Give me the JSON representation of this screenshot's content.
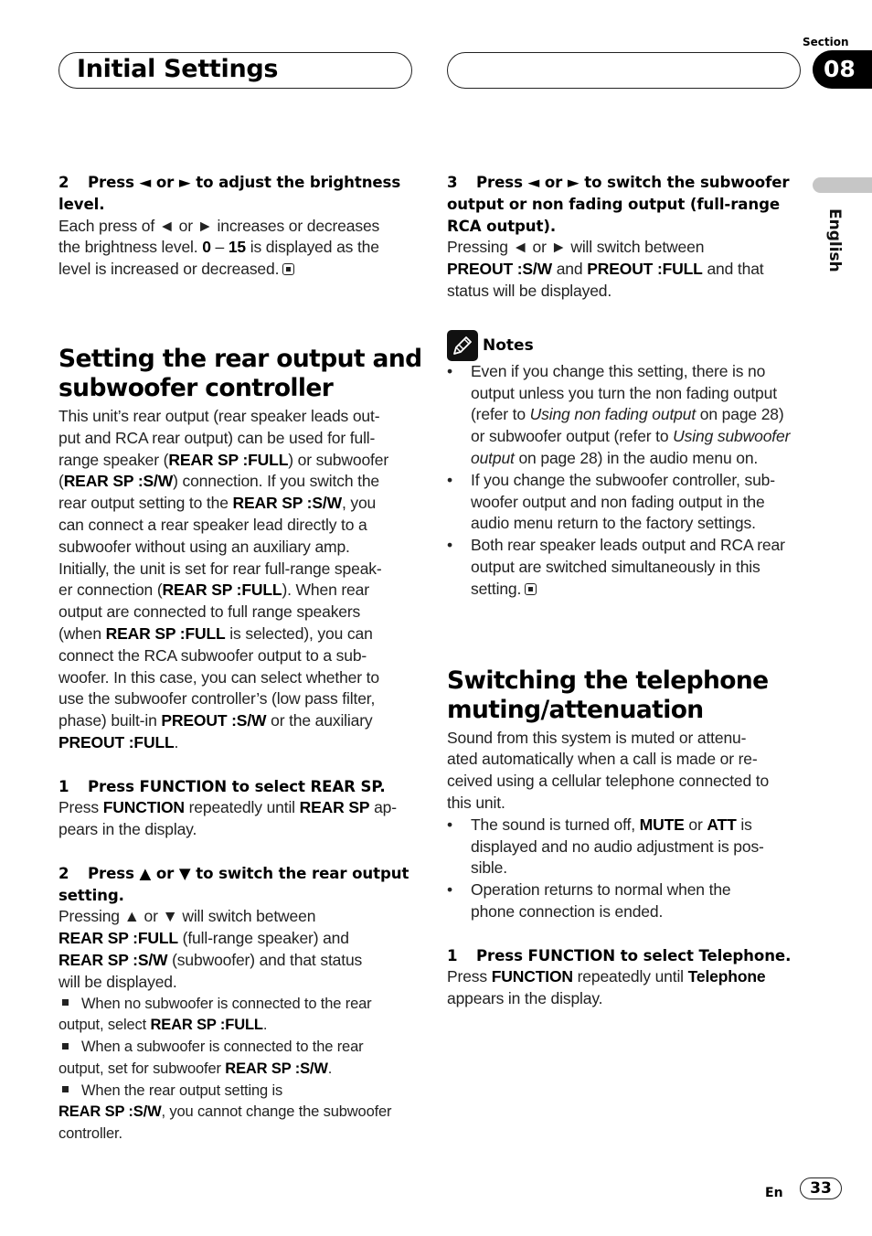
{
  "header": {
    "title": "Initial Settings",
    "section_label": "Section",
    "section_number": "08",
    "language": "English"
  },
  "footer": {
    "lang_code": "En",
    "page_number": "33"
  },
  "left_column": {
    "step2_brightness": {
      "heading_lines": [
        [
          {
            "t": "2",
            "num": true
          },
          {
            "t": "Press ◄ or ► to adjust the brightness"
          }
        ],
        [
          {
            "t": "level."
          }
        ]
      ],
      "body_lines": [
        [
          {
            "t": "Each press of ◄ or ► increases or decreases"
          }
        ],
        [
          {
            "t": "the brightness level. "
          },
          {
            "t": "0",
            "b": true
          },
          {
            "t": " – "
          },
          {
            "t": "15",
            "b": true
          },
          {
            "t": " is displayed as the"
          }
        ],
        [
          {
            "t": "level is increased or decreased."
          },
          {
            "end": true
          }
        ]
      ]
    },
    "rear_output_section": {
      "title_lines": [
        "Setting the rear output and",
        "subwoofer controller"
      ],
      "intro_lines": [
        [
          {
            "t": "This unit’s rear output (rear speaker leads out-"
          }
        ],
        [
          {
            "t": "put and RCA rear output) can be used for full-"
          }
        ],
        [
          {
            "t": "range speaker ("
          },
          {
            "t": "REAR SP :FULL",
            "b": true
          },
          {
            "t": ") or subwoofer"
          }
        ],
        [
          {
            "t": "("
          },
          {
            "t": "REAR SP :S/W",
            "b": true
          },
          {
            "t": ") connection. If you switch the"
          }
        ],
        [
          {
            "t": "rear output setting to the "
          },
          {
            "t": "REAR SP :S/W",
            "b": true
          },
          {
            "t": ", you"
          }
        ],
        [
          {
            "t": "can connect a rear speaker lead directly to a"
          }
        ],
        [
          {
            "t": "subwoofer without using an auxiliary amp."
          }
        ],
        [
          {
            "t": "Initially, the unit is set for rear full-range speak-"
          }
        ],
        [
          {
            "t": "er connection ("
          },
          {
            "t": "REAR SP :FULL",
            "b": true
          },
          {
            "t": "). When rear"
          }
        ],
        [
          {
            "t": "output are connected to full range speakers"
          }
        ],
        [
          {
            "t": "(when "
          },
          {
            "t": "REAR SP :FULL",
            "b": true
          },
          {
            "t": " is selected), you can"
          }
        ],
        [
          {
            "t": "connect the RCA subwoofer output to a sub-"
          }
        ],
        [
          {
            "t": "woofer. In this case, you can select whether to"
          }
        ],
        [
          {
            "t": "use the subwoofer controller’s (low pass filter,"
          }
        ],
        [
          {
            "t": "phase) built-in "
          },
          {
            "t": "PREOUT :S/W",
            "b": true
          },
          {
            "t": " or the auxiliary"
          }
        ],
        [
          {
            "t": "PREOUT :FULL",
            "b": true
          },
          {
            "t": "."
          }
        ]
      ],
      "step1": {
        "heading_lines": [
          [
            {
              "t": "1",
              "num": true
            },
            {
              "t": "Press FUNCTION to select REAR SP."
            }
          ]
        ],
        "body_lines": [
          [
            {
              "t": "Press "
            },
            {
              "t": "FUNCTION",
              "b": true
            },
            {
              "t": " repeatedly until "
            },
            {
              "t": "REAR SP",
              "b": true
            },
            {
              "t": " ap-"
            }
          ],
          [
            {
              "t": "pears in the display."
            }
          ]
        ]
      },
      "step2": {
        "heading_lines": [
          [
            {
              "t": "2",
              "num": true
            },
            {
              "t": "Press ▲ or ▼ to switch the rear output"
            }
          ],
          [
            {
              "t": "setting."
            }
          ]
        ],
        "body_lines": [
          [
            {
              "t": "Pressing ▲ or ▼ will switch between"
            }
          ],
          [
            {
              "t": "REAR SP :FULL",
              "b": true
            },
            {
              "t": " (full-range speaker) and"
            }
          ],
          [
            {
              "t": "REAR SP :S/W",
              "b": true
            },
            {
              "t": " (subwoofer) and that status"
            }
          ],
          [
            {
              "t": "will be displayed."
            }
          ]
        ],
        "square_notes": [
          [
            [
              {
                "sq": true
              },
              {
                "t": "When no subwoofer is connected to the rear"
              }
            ],
            [
              {
                "t": "output, select "
              },
              {
                "t": "REAR SP :FULL",
                "b": true
              },
              {
                "t": "."
              }
            ]
          ],
          [
            [
              {
                "sq": true
              },
              {
                "t": "When a subwoofer is connected to the rear"
              }
            ],
            [
              {
                "t": "output, set for subwoofer "
              },
              {
                "t": "REAR SP :S/W",
                "b": true
              },
              {
                "t": "."
              }
            ]
          ],
          [
            [
              {
                "sq": true
              },
              {
                "t": "When the rear output setting is"
              }
            ],
            [
              {
                "t": "REAR SP :S/W",
                "b": true
              },
              {
                "t": ", you cannot change the subwoofer"
              }
            ],
            [
              {
                "t": "controller."
              }
            ]
          ]
        ]
      }
    }
  },
  "right_column": {
    "step3": {
      "heading_lines": [
        [
          {
            "t": "3",
            "num": true
          },
          {
            "t": "Press ◄ or ► to switch the subwoofer"
          }
        ],
        [
          {
            "t": "output or non fading output (full-range"
          }
        ],
        [
          {
            "t": "RCA output)."
          }
        ]
      ],
      "body_lines": [
        [
          {
            "t": "Pressing ◄ or ► will switch between"
          }
        ],
        [
          {
            "t": "PREOUT :S/W",
            "b": true
          },
          {
            "t": " and "
          },
          {
            "t": "PREOUT :FULL",
            "b": true
          },
          {
            "t": " and that"
          }
        ],
        [
          {
            "t": "status will be displayed."
          }
        ]
      ]
    },
    "notes": {
      "title": "Notes",
      "items": [
        [
          [
            {
              "t": "Even if you change this setting, there is no"
            }
          ],
          [
            {
              "t": "output unless you turn the non fading output"
            }
          ],
          [
            {
              "t": "(refer to "
            },
            {
              "t": "Using non fading output",
              "i": true
            },
            {
              "t": " on page 28)"
            }
          ],
          [
            {
              "t": "or subwoofer output (refer to "
            },
            {
              "t": "Using subwoofer",
              "i": true
            }
          ],
          [
            {
              "t": "output",
              "i": true
            },
            {
              "t": " on page 28) in the audio menu on."
            }
          ]
        ],
        [
          [
            {
              "t": "If you change the subwoofer controller, sub-"
            }
          ],
          [
            {
              "t": "woofer output and non fading output in the"
            }
          ],
          [
            {
              "t": "audio menu return to the factory settings."
            }
          ]
        ],
        [
          [
            {
              "t": "Both rear speaker leads output and RCA rear"
            }
          ],
          [
            {
              "t": "output are switched simultaneously in this"
            }
          ],
          [
            {
              "t": "setting."
            },
            {
              "end": true
            }
          ]
        ]
      ]
    },
    "telephone_section": {
      "title_lines": [
        "Switching the telephone",
        "muting/attenuation"
      ],
      "intro_lines": [
        [
          {
            "t": "Sound from this system is muted or attenu-"
          }
        ],
        [
          {
            "t": "ated automatically when a call is made or re-"
          }
        ],
        [
          {
            "t": "ceived using a cellular telephone connected to"
          }
        ],
        [
          {
            "t": "this unit."
          }
        ]
      ],
      "bullets": [
        [
          [
            {
              "t": "The sound is turned off, "
            },
            {
              "t": "MUTE",
              "b": true
            },
            {
              "t": " or "
            },
            {
              "t": "ATT",
              "b": true
            },
            {
              "t": " is"
            }
          ],
          [
            {
              "t": "displayed and no audio adjustment is pos-"
            }
          ],
          [
            {
              "t": "sible."
            }
          ]
        ],
        [
          [
            {
              "t": "Operation returns to normal when the"
            }
          ],
          [
            {
              "t": "phone connection is ended."
            }
          ]
        ]
      ],
      "step1": {
        "heading_lines": [
          [
            {
              "t": "1",
              "num": true
            },
            {
              "t": "Press FUNCTION to select Telephone."
            }
          ]
        ],
        "body_lines": [
          [
            {
              "t": "Press "
            },
            {
              "t": "FUNCTION",
              "b": true
            },
            {
              "t": " repeatedly until "
            },
            {
              "t": "Telephone",
              "b": true
            }
          ],
          [
            {
              "t": "appears in the display."
            }
          ]
        ]
      }
    }
  }
}
